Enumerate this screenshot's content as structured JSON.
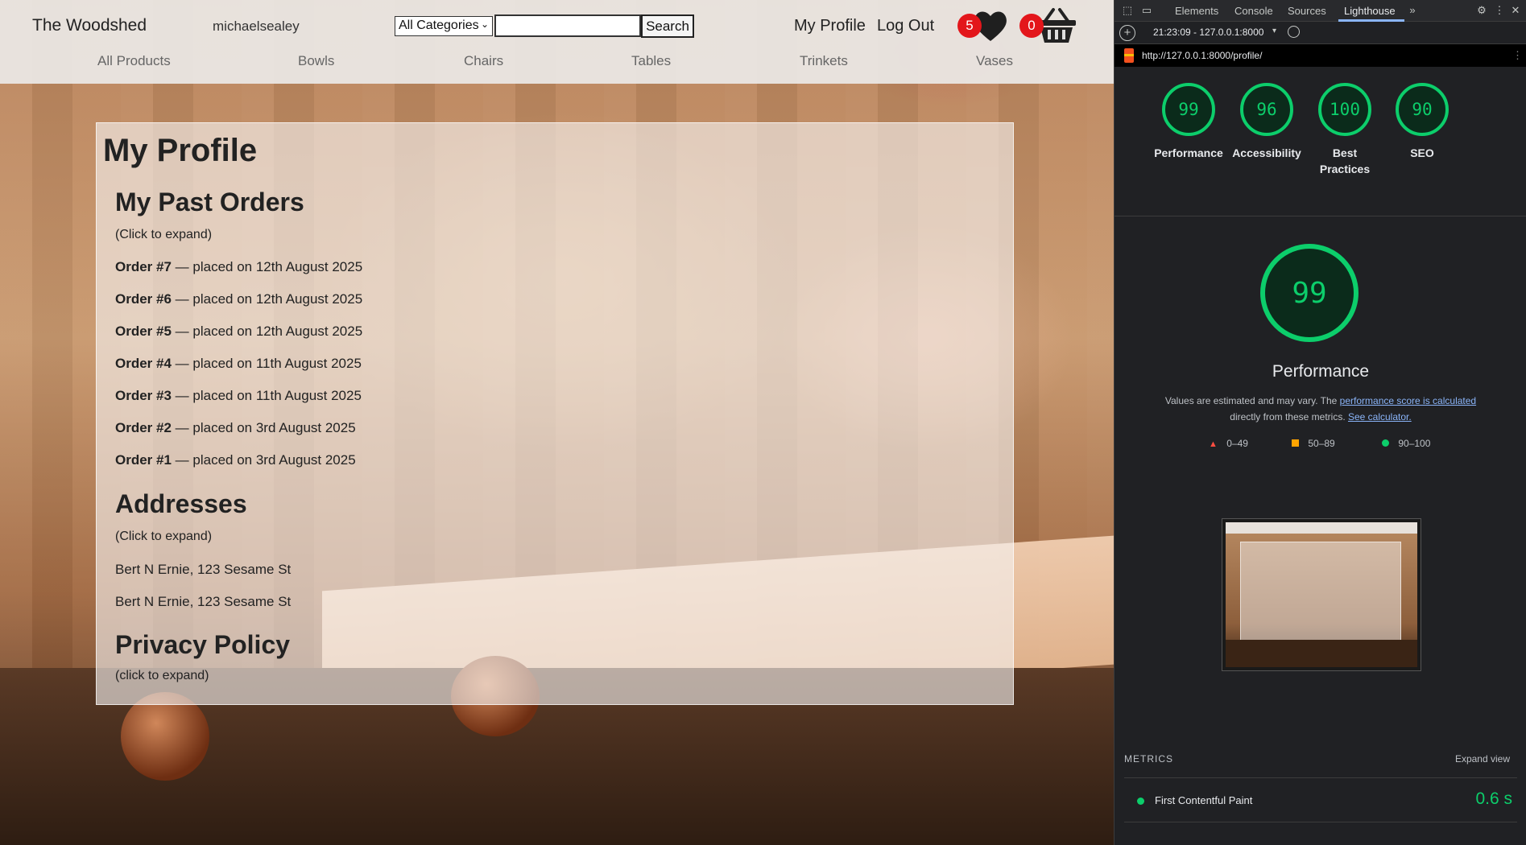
{
  "site": {
    "brand": "The Woodshed",
    "username": "michaelsealey",
    "category_select": "All Categories",
    "search_button": "Search",
    "my_profile": "My Profile",
    "log_out": "Log Out",
    "wishlist_count": "5",
    "cart_count": "0",
    "categories": [
      "All Products",
      "Bowls",
      "Chairs",
      "Tables",
      "Trinkets",
      "Vases"
    ]
  },
  "profile": {
    "title": "My Profile",
    "orders_title": "My Past Orders",
    "orders_hint": "(Click to expand)",
    "orders": [
      {
        "num": "Order #7",
        "text": " — placed on 12th August 2025"
      },
      {
        "num": "Order #6",
        "text": " — placed on 12th August 2025"
      },
      {
        "num": "Order #5",
        "text": " — placed on 12th August 2025"
      },
      {
        "num": "Order #4",
        "text": " — placed on 11th August 2025"
      },
      {
        "num": "Order #3",
        "text": " — placed on 11th August 2025"
      },
      {
        "num": "Order #2",
        "text": " — placed on 3rd August 2025"
      },
      {
        "num": "Order #1",
        "text": " — placed on 3rd August 2025"
      }
    ],
    "addresses_title": "Addresses",
    "addresses_hint": "(Click to expand)",
    "addresses": [
      "Bert N Ernie, 123 Sesame St",
      "Bert N Ernie, 123 Sesame St"
    ],
    "privacy_title": "Privacy Policy",
    "privacy_hint": "(click to expand)"
  },
  "devtools": {
    "tabs": [
      "Elements",
      "Console",
      "Sources",
      "Lighthouse"
    ],
    "active_tab": "Lighthouse",
    "run_label": "21:23:09 - 127.0.0.1:8000",
    "url": "http://127.0.0.1:8000/profile/",
    "scores": [
      {
        "value": "99",
        "label": "Performance"
      },
      {
        "value": "96",
        "label": "Accessibility"
      },
      {
        "value": "100",
        "label": "Best Practices"
      },
      {
        "value": "90",
        "label": "SEO"
      }
    ],
    "main_score": "99",
    "main_title": "Performance",
    "desc_prefix": "Values are estimated and may vary. The ",
    "desc_link1": "performance score is calculated",
    "desc_middle": " directly from these metrics. ",
    "desc_link2": "See calculator.",
    "legend": [
      "0–49",
      "50–89",
      "90–100"
    ],
    "metrics_heading": "METRICS",
    "expand_view": "Expand view",
    "metric_name": "First Contentful Paint",
    "metric_value": "0.6 s",
    "pass_color": "#0cce6b"
  }
}
